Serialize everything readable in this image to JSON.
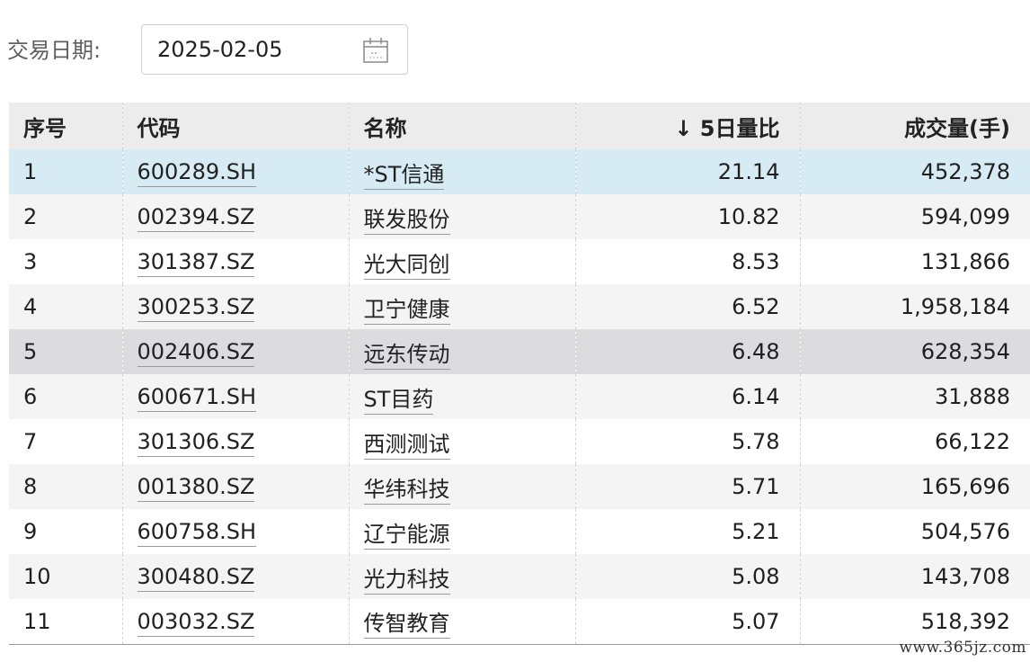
{
  "filter": {
    "date_label": "交易日期:",
    "date_value": "2025-02-05",
    "date_icon": "calendar-icon"
  },
  "table": {
    "sort_indicator": "↓",
    "columns": [
      "序号",
      "代码",
      "名称",
      "5日量比",
      "成交量(手)"
    ],
    "sorted_column": "5日量比",
    "rows": [
      {
        "seq": "1",
        "code": "600289.SH",
        "name": "*ST信通",
        "ratio": "21.14",
        "volume": "452,378",
        "state": "selected"
      },
      {
        "seq": "2",
        "code": "002394.SZ",
        "name": "联发股份",
        "ratio": "10.82",
        "volume": "594,099",
        "state": ""
      },
      {
        "seq": "3",
        "code": "301387.SZ",
        "name": "光大同创",
        "ratio": "8.53",
        "volume": "131,866",
        "state": ""
      },
      {
        "seq": "4",
        "code": "300253.SZ",
        "name": "卫宁健康",
        "ratio": "6.52",
        "volume": "1,958,184",
        "state": ""
      },
      {
        "seq": "5",
        "code": "002406.SZ",
        "name": "远东传动",
        "ratio": "6.48",
        "volume": "628,354",
        "state": "hover"
      },
      {
        "seq": "6",
        "code": "600671.SH",
        "name": "ST目药",
        "ratio": "6.14",
        "volume": "31,888",
        "state": ""
      },
      {
        "seq": "7",
        "code": "301306.SZ",
        "name": "西测测试",
        "ratio": "5.78",
        "volume": "66,122",
        "state": ""
      },
      {
        "seq": "8",
        "code": "001380.SZ",
        "name": "华纬科技",
        "ratio": "5.71",
        "volume": "165,696",
        "state": ""
      },
      {
        "seq": "9",
        "code": "600758.SH",
        "name": "辽宁能源",
        "ratio": "5.21",
        "volume": "504,576",
        "state": ""
      },
      {
        "seq": "10",
        "code": "300480.SZ",
        "name": "光力科技",
        "ratio": "5.08",
        "volume": "143,708",
        "state": ""
      },
      {
        "seq": "11",
        "code": "003032.SZ",
        "name": "传智教育",
        "ratio": "5.07",
        "volume": "518,392",
        "state": ""
      }
    ]
  },
  "watermark": "www.365jz.com",
  "colors": {
    "header_bg": "#ececec",
    "selected_row": "#d6ebf3",
    "hover_row": "#dcdcde",
    "stripe_row": "#f4f4f4"
  }
}
